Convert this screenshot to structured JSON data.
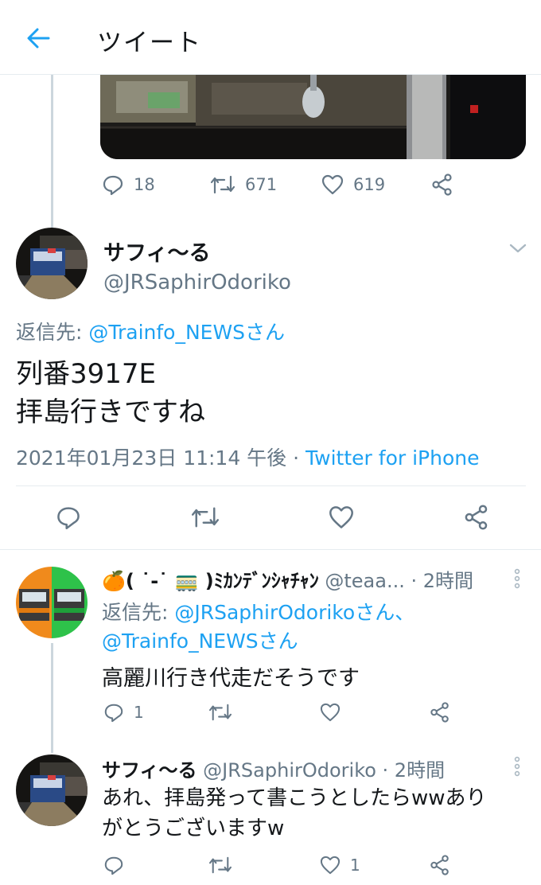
{
  "header": {
    "title": "ツイート",
    "back_icon": "back-arrow-icon"
  },
  "prev_tweet": {
    "reply_count": "18",
    "retweet_count": "671",
    "like_count": "619"
  },
  "main_tweet": {
    "name": "サフィ〜る",
    "handle": "@JRSaphirOdoriko",
    "reply_to_label": "返信先: ",
    "reply_to_user": "@Trainfo_NEWSさん",
    "text_line1": "列番3917E",
    "text_line2": "拝島行きですね",
    "timestamp": "2021年01月23日 11:14 午後 · ",
    "source": "Twitter for iPhone"
  },
  "reply1": {
    "name": "🍊( ˙-˙ 🚃 )ﾐｶﾝﾃﾞﾝｼｬﾁｬﾝ",
    "handle": "@teaa...",
    "time": " · 2時間",
    "reply_to_label": "返信先: ",
    "reply_to_user1": "@JRSaphirOdorikoさん、",
    "reply_to_user2": "@Trainfo_NEWSさん",
    "text": "高麗川行き代走だそうです",
    "reply_count": "1",
    "retweet_count": "",
    "like_count": ""
  },
  "reply2": {
    "name": "サフィ〜る",
    "handle": "@JRSaphirOdoriko",
    "time": " · 2時間",
    "text_line1": "あれ、拝島発って書こうとしたらwwあり",
    "text_line2": "がとうございますw",
    "reply_count": "",
    "retweet_count": "",
    "like_count": "1"
  },
  "colors": {
    "accent": "#1da1f2",
    "muted": "#657786",
    "divider": "#e6ecf0"
  }
}
